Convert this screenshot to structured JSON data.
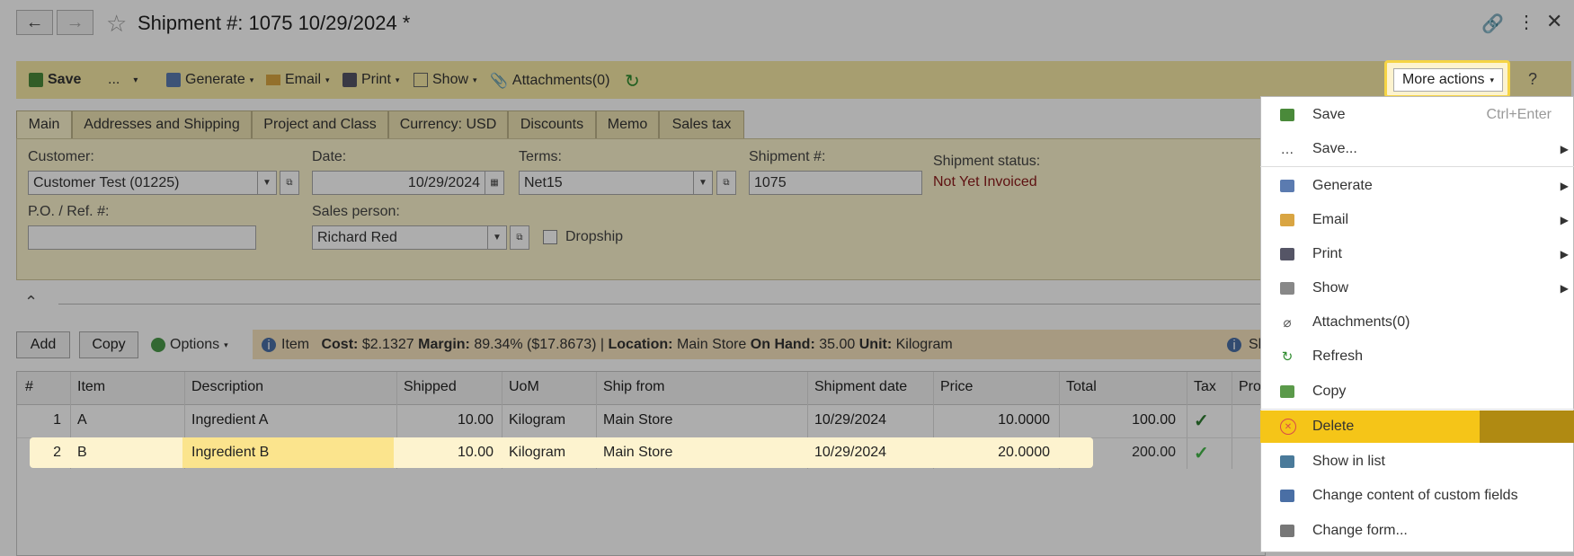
{
  "window": {
    "title": "Shipment #: 1075 10/29/2024 *",
    "back_icon": "arrow-left-icon",
    "forward_icon": "arrow-right-icon",
    "favorite_icon": "star-icon",
    "link_icon": "link-icon",
    "more_icon": "vertical-dots-icon",
    "close_icon": "close-icon"
  },
  "toolbar": {
    "save": "Save",
    "dots": "...",
    "generate": "Generate",
    "email": "Email",
    "print": "Print",
    "show": "Show",
    "attachments": "Attachments(0)",
    "more_actions": "More actions",
    "help": "?"
  },
  "tabs": [
    "Main",
    "Addresses and Shipping",
    "Project and Class",
    "Currency: USD",
    "Discounts",
    "Memo",
    "Sales tax"
  ],
  "form": {
    "customer_label": "Customer:",
    "customer_value": "Customer Test (01225)",
    "date_label": "Date:",
    "date_value": "10/29/2024",
    "terms_label": "Terms:",
    "terms_value": "Net15",
    "shipment_label": "Shipment #:",
    "shipment_value": "1075",
    "status_label": "Shipment status:",
    "status_value": "Not Yet Invoiced",
    "po_label": "P.O. / Ref. #:",
    "po_value": "",
    "salesperson_label": "Sales person:",
    "salesperson_value": "Richard Red",
    "dropship_label": "Dropship"
  },
  "grid_toolbar": {
    "add": "Add",
    "copy": "Copy",
    "options": "Options",
    "info_item": "Item",
    "info_cost_label": "Cost:",
    "info_cost": "$2.1327",
    "info_margin_label": "Margin:",
    "info_margin": "89.34% ($17.8673) |",
    "info_location_label": "Location:",
    "info_location": "Main Store",
    "info_onhand_label": "On Hand:",
    "info_onhand": "35.00",
    "info_unit_label": "Unit:",
    "info_unit": "Kilogram",
    "info_right": "Sh"
  },
  "grid": {
    "columns": [
      "#",
      "Item",
      "Description",
      "Shipped",
      "UoM",
      "Ship from",
      "Shipment date",
      "Price",
      "Total",
      "Tax",
      "Pro"
    ],
    "rows": [
      {
        "num": "1",
        "item": "A",
        "description": "Ingredient A",
        "shipped": "10.00",
        "uom": "Kilogram",
        "ship_from": "Main Store",
        "date": "10/29/2024",
        "price": "10.0000",
        "total": "100.00",
        "tax": "✓"
      },
      {
        "num": "2",
        "item": "B",
        "description": "Ingredient B",
        "shipped": "10.00",
        "uom": "Kilogram",
        "ship_from": "Main Store",
        "date": "10/29/2024",
        "price": "20.0000",
        "total": "200.00",
        "tax": "✓"
      }
    ]
  },
  "menu": {
    "items": [
      {
        "label": "Save",
        "shortcut": "Ctrl+Enter",
        "icon": "save-icon"
      },
      {
        "label": "Save...",
        "icon": "dots-icon"
      },
      {
        "label": "Generate",
        "icon": "generate-icon"
      },
      {
        "label": "Email",
        "icon": "email-icon"
      },
      {
        "label": "Print",
        "icon": "print-icon"
      },
      {
        "label": "Show",
        "icon": "chart-icon"
      },
      {
        "label": "Attachments(0)",
        "icon": "paperclip-icon"
      },
      {
        "label": "Refresh",
        "icon": "refresh-icon"
      },
      {
        "label": "Copy",
        "icon": "copy-icon"
      },
      {
        "label": "Delete",
        "icon": "delete-icon"
      },
      {
        "label": "Show in list",
        "icon": "list-icon"
      },
      {
        "label": "Change content of custom fields",
        "icon": "custom-fields-icon"
      },
      {
        "label": "Change form...",
        "icon": "form-icon"
      }
    ]
  },
  "colors": {
    "highlight": "#f5c518",
    "toolbar_bg": "#f6e9a6",
    "status_red": "#8b1a1a",
    "check_green": "#2e7d32"
  }
}
